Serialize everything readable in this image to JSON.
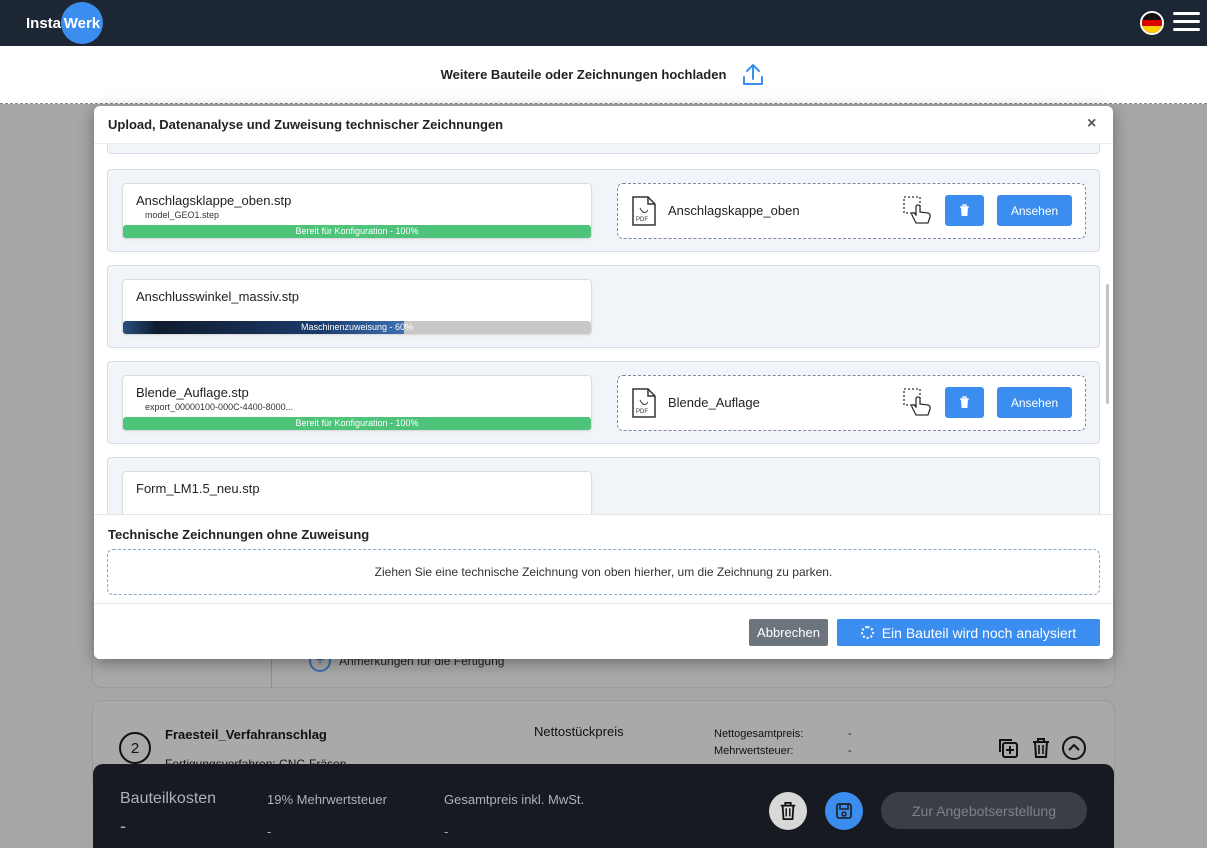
{
  "nav": {
    "logo_left": "Insta",
    "logo_right": "Werk",
    "language_flag_icon": "german-flag-icon",
    "menu_icon": "hamburger-menu-icon"
  },
  "upload_strip": {
    "label": "Weitere Bauteile oder Zeichnungen hochladen",
    "icon": "upload-icon"
  },
  "modal": {
    "title": "Upload, Datenanalyse und Zuweisung technischer Zeichnungen",
    "close_label": "×",
    "rows": [
      {
        "file_name": "Anschlagsklappe_oben.stp",
        "sub_file": "model_GEO1.step",
        "status": "Bereit für Konfiguration - 100%",
        "progress": 1.0,
        "status_color": "#4dc47a",
        "drawing": {
          "name": "Anschlagskappe_oben",
          "view_label": "Ansehen"
        }
      },
      {
        "file_name": "Anschlusswinkel_massiv.stp",
        "sub_file": "",
        "status": "Maschinenzuweisung - 60%",
        "progress": 0.6,
        "status_color": "#1b3c6a",
        "drawing": null
      },
      {
        "file_name": "Blende_Auflage.stp",
        "sub_file": "export_00000100-000C-4400-8000...",
        "status": "Bereit für Konfiguration - 100%",
        "progress": 1.0,
        "status_color": "#4dc47a",
        "drawing": {
          "name": "Blende_Auflage",
          "view_label": "Ansehen"
        }
      },
      {
        "file_name": "Form_LM1.5_neu.stp",
        "sub_file": "",
        "status": "",
        "progress": 0,
        "status_color": "#c8c8c8",
        "drawing": null
      }
    ],
    "unassigned": {
      "title": "Technische Zeichnungen ohne Zuweisung",
      "drop_hint": "Ziehen Sie eine technische Zeichnung von oben hierher, um die Zeichnung zu parken."
    },
    "footer": {
      "cancel_label": "Abbrechen",
      "analyze_label": "Ein Bauteil wird noch analysiert"
    }
  },
  "background": {
    "note_label": "Anmerkungen für die Fertigung",
    "part_number": "2",
    "part_title": "Fraesteil_Verfahranschlag",
    "part_sub": "Fertigungsverfahren: CNC-Fräsen",
    "netto_label": "Nettostückpreis",
    "netto_total_label": "Nettogesamtpreis:",
    "netto_total_value": "-",
    "vat_label": "Mehrwertsteuer:",
    "vat_value": "-"
  },
  "bottom_bar": {
    "cost_label": "Bauteilkosten",
    "cost_value": "-",
    "vat_label": "19% Mehrwertsteuer",
    "vat_value": "-",
    "total_label": "Gesamtpreis inkl. MwSt.",
    "total_value": "-",
    "offer_label": "Zur Angebotserstellung"
  }
}
